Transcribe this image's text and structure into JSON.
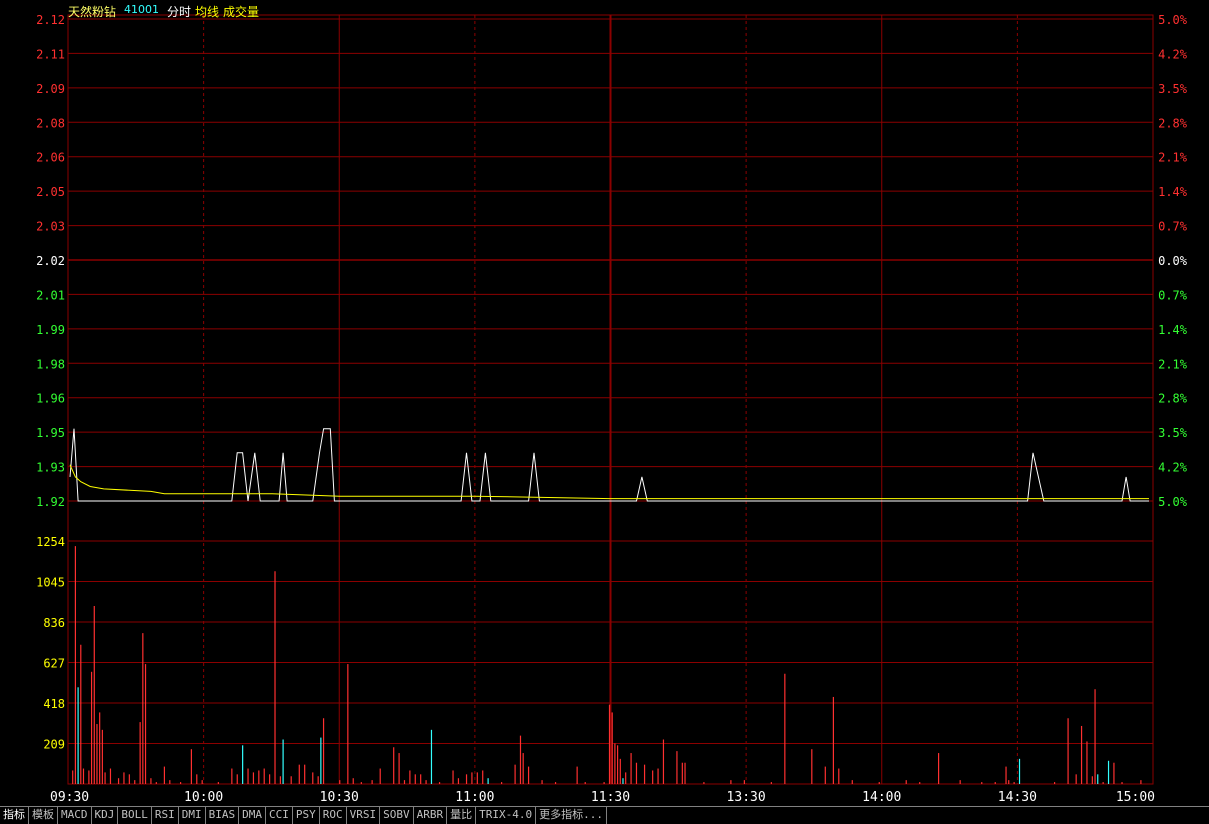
{
  "header": {
    "name": "天然粉钻",
    "code": "41001",
    "labels": [
      "分时",
      "均线",
      "成交量"
    ]
  },
  "colors": {
    "grid": "#8b0000",
    "up": "#ff3030",
    "down": "#33ff33",
    "flat": "#ffffff",
    "avg": "#ffff00",
    "volume_up": "#ff3030",
    "volume_down": "#33ffff",
    "time": "#ffffff"
  },
  "price_axis": {
    "left_labels": [
      "2.12",
      "2.11",
      "2.09",
      "2.08",
      "2.06",
      "2.05",
      "2.03",
      "2.02",
      "2.01",
      "1.99",
      "1.98",
      "1.96",
      "1.95",
      "1.93",
      "1.92"
    ],
    "right_labels": [
      "5.0%",
      "4.2%",
      "3.5%",
      "2.8%",
      "2.1%",
      "1.4%",
      "0.7%",
      "0.0%",
      "0.7%",
      "1.4%",
      "2.1%",
      "2.8%",
      "3.5%",
      "4.2%",
      "5.0%"
    ],
    "reference": 2.02
  },
  "volume_axis": {
    "labels": [
      "1254",
      "1045",
      "836",
      "627",
      "418",
      "209"
    ]
  },
  "time_labels": [
    "09:30",
    "10:00",
    "10:30",
    "11:00",
    "11:30",
    "13:30",
    "14:00",
    "14:30",
    "15:00"
  ],
  "chart_data": {
    "type": "line",
    "title": "天然粉钻 41001 分时",
    "x": [
      "09:30",
      "10:00",
      "10:30",
      "11:00",
      "11:30",
      "13:30",
      "14:00",
      "14:30",
      "15:00"
    ],
    "ylim": [
      1.92,
      2.12
    ],
    "series": [
      {
        "name": "分时",
        "points": [
          [
            0,
            1.93
          ],
          [
            3,
            1.95
          ],
          [
            6,
            1.92
          ],
          [
            120,
            1.92
          ],
          [
            124,
            1.94
          ],
          [
            128,
            1.94
          ],
          [
            132,
            1.92
          ],
          [
            137,
            1.94
          ],
          [
            141,
            1.92
          ],
          [
            155,
            1.92
          ],
          [
            158,
            1.94
          ],
          [
            161,
            1.92
          ],
          [
            180,
            1.92
          ],
          [
            185,
            1.94
          ],
          [
            188,
            1.95
          ],
          [
            193,
            1.95
          ],
          [
            196,
            1.92
          ],
          [
            290,
            1.92
          ],
          [
            294,
            1.94
          ],
          [
            298,
            1.92
          ],
          [
            304,
            1.92
          ],
          [
            308,
            1.94
          ],
          [
            312,
            1.92
          ],
          [
            340,
            1.92
          ],
          [
            344,
            1.94
          ],
          [
            348,
            1.92
          ],
          [
            420,
            1.92
          ],
          [
            424,
            1.93
          ],
          [
            428,
            1.92
          ],
          [
            710,
            1.92
          ],
          [
            714,
            1.94
          ],
          [
            718,
            1.93
          ],
          [
            722,
            1.92
          ],
          [
            780,
            1.92
          ],
          [
            783,
            1.93
          ],
          [
            786,
            1.92
          ],
          [
            800,
            1.92
          ]
        ]
      },
      {
        "name": "均线",
        "points": [
          [
            0,
            1.935
          ],
          [
            4,
            1.93
          ],
          [
            8,
            1.928
          ],
          [
            15,
            1.926
          ],
          [
            25,
            1.925
          ],
          [
            60,
            1.924
          ],
          [
            70,
            1.923
          ],
          [
            150,
            1.923
          ],
          [
            200,
            1.922
          ],
          [
            300,
            1.922
          ],
          [
            400,
            1.921
          ],
          [
            800,
            1.921
          ]
        ]
      }
    ],
    "volume": {
      "ylim": [
        0,
        1463
      ],
      "bars": [
        [
          2,
          70,
          "u"
        ],
        [
          4,
          1230,
          "u"
        ],
        [
          6,
          500,
          "d"
        ],
        [
          8,
          720,
          "u"
        ],
        [
          10,
          80,
          "u"
        ],
        [
          14,
          70,
          "u"
        ],
        [
          16,
          580,
          "u"
        ],
        [
          18,
          920,
          "u"
        ],
        [
          20,
          310,
          "u"
        ],
        [
          22,
          370,
          "u"
        ],
        [
          24,
          280,
          "u"
        ],
        [
          26,
          60,
          "u"
        ],
        [
          30,
          80,
          "u"
        ],
        [
          36,
          30,
          "u"
        ],
        [
          40,
          60,
          "u"
        ],
        [
          44,
          50,
          "u"
        ],
        [
          48,
          20,
          "u"
        ],
        [
          52,
          320,
          "u"
        ],
        [
          54,
          780,
          "u"
        ],
        [
          56,
          620,
          "u"
        ],
        [
          60,
          30,
          "u"
        ],
        [
          64,
          10,
          "u"
        ],
        [
          70,
          90,
          "u"
        ],
        [
          74,
          20,
          "u"
        ],
        [
          82,
          10,
          "u"
        ],
        [
          90,
          180,
          "u"
        ],
        [
          94,
          50,
          "u"
        ],
        [
          98,
          20,
          "u"
        ],
        [
          110,
          10,
          "u"
        ],
        [
          120,
          80,
          "u"
        ],
        [
          124,
          50,
          "u"
        ],
        [
          128,
          200,
          "d"
        ],
        [
          132,
          80,
          "u"
        ],
        [
          136,
          60,
          "u"
        ],
        [
          140,
          70,
          "u"
        ],
        [
          144,
          80,
          "u"
        ],
        [
          148,
          50,
          "u"
        ],
        [
          152,
          1100,
          "u"
        ],
        [
          156,
          40,
          "u"
        ],
        [
          158,
          230,
          "d"
        ],
        [
          164,
          40,
          "u"
        ],
        [
          170,
          100,
          "u"
        ],
        [
          174,
          100,
          "u"
        ],
        [
          180,
          60,
          "u"
        ],
        [
          184,
          40,
          "u"
        ],
        [
          186,
          240,
          "d"
        ],
        [
          188,
          340,
          "u"
        ],
        [
          200,
          20,
          "u"
        ],
        [
          206,
          620,
          "u"
        ],
        [
          210,
          30,
          "u"
        ],
        [
          216,
          10,
          "u"
        ],
        [
          224,
          20,
          "u"
        ],
        [
          230,
          80,
          "u"
        ],
        [
          240,
          190,
          "u"
        ],
        [
          244,
          160,
          "u"
        ],
        [
          248,
          20,
          "u"
        ],
        [
          252,
          70,
          "u"
        ],
        [
          256,
          50,
          "u"
        ],
        [
          260,
          50,
          "u"
        ],
        [
          264,
          20,
          "u"
        ],
        [
          268,
          280,
          "d"
        ],
        [
          274,
          10,
          "u"
        ],
        [
          284,
          70,
          "u"
        ],
        [
          288,
          30,
          "u"
        ],
        [
          294,
          50,
          "u"
        ],
        [
          298,
          60,
          "u"
        ],
        [
          302,
          60,
          "u"
        ],
        [
          306,
          70,
          "u"
        ],
        [
          310,
          30,
          "d"
        ],
        [
          320,
          10,
          "u"
        ],
        [
          330,
          100,
          "u"
        ],
        [
          334,
          250,
          "u"
        ],
        [
          336,
          160,
          "u"
        ],
        [
          340,
          90,
          "u"
        ],
        [
          350,
          20,
          "u"
        ],
        [
          360,
          10,
          "u"
        ],
        [
          376,
          90,
          "u"
        ],
        [
          382,
          10,
          "u"
        ],
        [
          396,
          10,
          "u"
        ],
        [
          400,
          410,
          "u"
        ],
        [
          402,
          370,
          "u"
        ],
        [
          404,
          210,
          "u"
        ],
        [
          406,
          200,
          "u"
        ],
        [
          408,
          130,
          "u"
        ],
        [
          410,
          30,
          "d"
        ],
        [
          412,
          60,
          "u"
        ],
        [
          416,
          160,
          "u"
        ],
        [
          420,
          110,
          "u"
        ],
        [
          426,
          100,
          "u"
        ],
        [
          432,
          70,
          "u"
        ],
        [
          436,
          80,
          "u"
        ],
        [
          440,
          230,
          "u"
        ],
        [
          450,
          170,
          "u"
        ],
        [
          454,
          110,
          "u"
        ],
        [
          456,
          110,
          "u"
        ],
        [
          470,
          10,
          "u"
        ],
        [
          490,
          20,
          "u"
        ],
        [
          500,
          20,
          "u"
        ],
        [
          520,
          10,
          "u"
        ],
        [
          530,
          570,
          "u"
        ],
        [
          550,
          180,
          "u"
        ],
        [
          560,
          90,
          "u"
        ],
        [
          566,
          450,
          "u"
        ],
        [
          570,
          80,
          "u"
        ],
        [
          580,
          20,
          "u"
        ],
        [
          600,
          10,
          "u"
        ],
        [
          620,
          20,
          "u"
        ],
        [
          630,
          10,
          "u"
        ],
        [
          644,
          160,
          "u"
        ],
        [
          660,
          20,
          "u"
        ],
        [
          676,
          10,
          "u"
        ],
        [
          686,
          10,
          "u"
        ],
        [
          694,
          90,
          "u"
        ],
        [
          696,
          20,
          "u"
        ],
        [
          700,
          10,
          "u"
        ],
        [
          704,
          130,
          "d"
        ],
        [
          730,
          10,
          "u"
        ],
        [
          740,
          340,
          "u"
        ],
        [
          746,
          50,
          "u"
        ],
        [
          750,
          300,
          "u"
        ],
        [
          754,
          220,
          "u"
        ],
        [
          758,
          40,
          "u"
        ],
        [
          760,
          490,
          "u"
        ],
        [
          762,
          50,
          "d"
        ],
        [
          766,
          10,
          "u"
        ],
        [
          770,
          120,
          "d"
        ],
        [
          774,
          110,
          "u"
        ],
        [
          780,
          10,
          "u"
        ],
        [
          794,
          20,
          "u"
        ]
      ]
    }
  },
  "bottom_tabs": [
    "指标",
    "模板",
    "MACD",
    "KDJ",
    "BOLL",
    "RSI",
    "DMI",
    "BIAS",
    "DMA",
    "CCI",
    "PSY",
    "ROC",
    "VRSI",
    "SOBV",
    "ARBR",
    "量比",
    "TRIX-4.0",
    "更多指标..."
  ]
}
